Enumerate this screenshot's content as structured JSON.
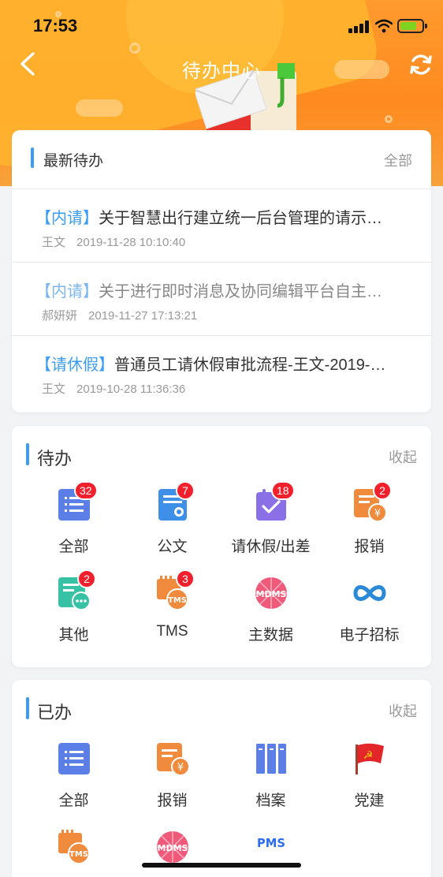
{
  "status_bar": {
    "time": "17:53"
  },
  "nav": {
    "title": "待办中心"
  },
  "latest": {
    "title": "最新待办",
    "more": "全部",
    "items": [
      {
        "tag": "【内请】",
        "subject": "关于智慧出行建立统一后台管理的请示…",
        "who": "王文",
        "time": "2019-11-28 10:10:40",
        "read": false
      },
      {
        "tag": "【内请】",
        "subject": "关于进行即时消息及协同编辑平台自主…",
        "who": "郝妍妍",
        "time": "2019-11-27 17:13:21",
        "read": true
      },
      {
        "tag": "【请休假】",
        "subject": "普通员工请休假审批流程-王文-2019-…",
        "who": "王文",
        "time": "2019-10-28 11:36:36",
        "read": false
      }
    ]
  },
  "pending": {
    "title": "待办",
    "more": "收起",
    "items": [
      {
        "label": "全部",
        "icon": "list-doc-icon",
        "badge": "32"
      },
      {
        "label": "公文",
        "icon": "official-doc-icon",
        "badge": "7"
      },
      {
        "label": "请休假/出差",
        "icon": "calendar-check-icon",
        "badge": "18"
      },
      {
        "label": "报销",
        "icon": "reimburse-icon",
        "badge": "2"
      },
      {
        "label": "其他",
        "icon": "other-doc-icon",
        "badge": "2"
      },
      {
        "label": "TMS",
        "icon": "tms-icon",
        "badge": "3"
      },
      {
        "label": "主数据",
        "icon": "mdms-icon",
        "badge": ""
      },
      {
        "label": "电子招标",
        "icon": "infinity-icon",
        "badge": ""
      }
    ]
  },
  "done": {
    "title": "已办",
    "more": "收起",
    "items": [
      {
        "label": "全部",
        "icon": "list-doc-icon"
      },
      {
        "label": "报销",
        "icon": "reimburse-icon"
      },
      {
        "label": "档案",
        "icon": "archive-icon"
      },
      {
        "label": "党建",
        "icon": "party-flag-icon"
      },
      {
        "label": "",
        "icon": "tms-icon"
      },
      {
        "label": "",
        "icon": "mdms-icon"
      },
      {
        "label": "",
        "icon": "pms-icon"
      }
    ]
  },
  "icon_text": {
    "tms": "TMS",
    "mdms": "MDMS",
    "pms": "PMS"
  },
  "colors": {
    "accent": "#3a9cf2",
    "header": "#ff9a2e",
    "badge": "#f0202c"
  }
}
